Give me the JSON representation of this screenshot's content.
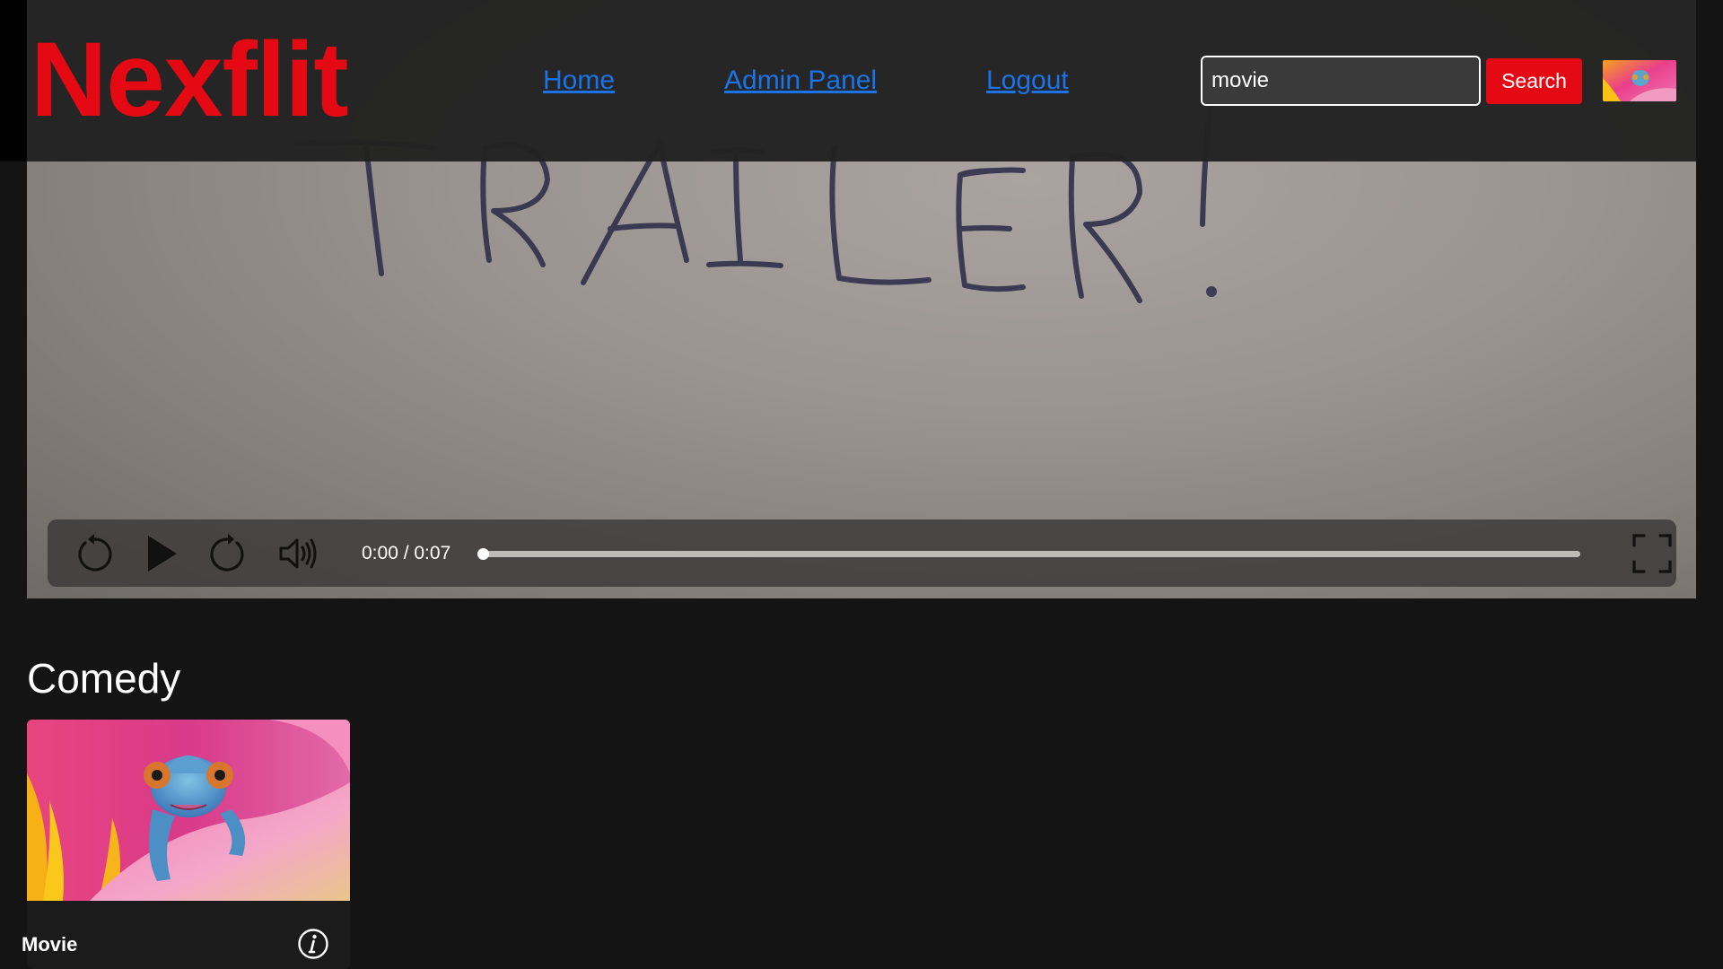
{
  "header": {
    "logo": "Nexflit",
    "nav": {
      "home": "Home",
      "admin": "Admin Panel",
      "logout": "Logout"
    },
    "search": {
      "value": "movie",
      "placeholder": "",
      "button_label": "Search"
    },
    "avatar_icon": "chameleon-avatar-icon"
  },
  "player": {
    "frame_handwriting": "TRAILER!",
    "time": "0:00 / 0:07",
    "progress": 0,
    "icons": [
      "rewind-icon",
      "play-icon",
      "forward-icon",
      "volume-icon",
      "fullscreen-icon"
    ]
  },
  "rows": [
    {
      "title": "Comedy",
      "items": [
        {
          "title": "Movie",
          "icon": "info-icon"
        }
      ]
    }
  ],
  "colors": {
    "brand": "#e50914",
    "link": "#1a73e8",
    "background": "#141414",
    "header": "#222222"
  }
}
